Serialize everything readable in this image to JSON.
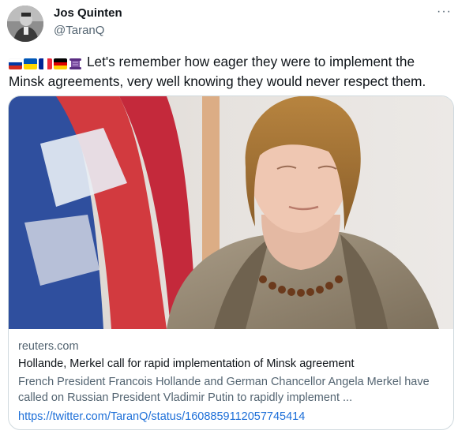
{
  "author": {
    "name": "Jos Quinten",
    "handle": "@TaranQ"
  },
  "menu": {
    "icon": "more-options-icon",
    "glyph": "···"
  },
  "tweet": {
    "flag_icons": [
      "russia-flag-icon",
      "ukraine-flag-icon",
      "france-flag-icon",
      "germany-flag-icon",
      "scroll-icon"
    ],
    "text": "Let's remember how eager they were to implement the Minsk agreements, very well knowing they would never respect them."
  },
  "card": {
    "domain": "reuters.com",
    "title": "Hollande, Merkel call for rapid implementation of Minsk agreement",
    "description": "French President Francois Hollande and German Chancellor Angela Merkel have called on Russian President Vladimir Putin to rapidly implement ...",
    "link": "https://twitter.com/TaranQ/status/1608859112057745414"
  }
}
